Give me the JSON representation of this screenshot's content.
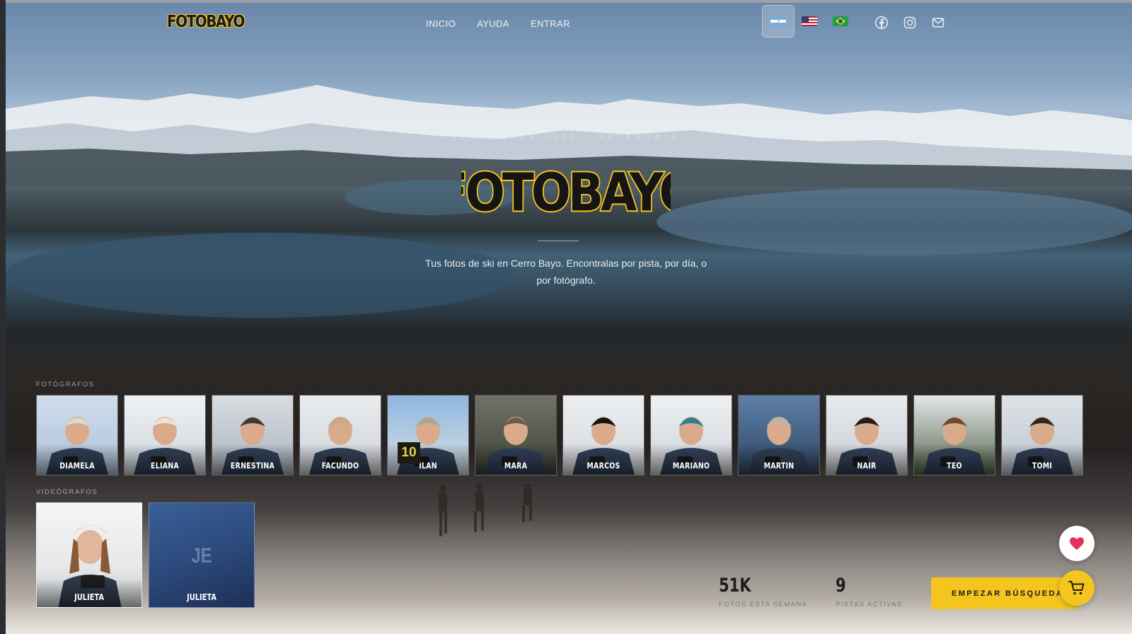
{
  "nav": {
    "logo": "FOTOBAYO",
    "links": [
      "INICIO",
      "AYUDA",
      "ENTRAR"
    ],
    "languages": [
      {
        "code": "ar",
        "icon": "argentina-flag-icon",
        "active": true
      },
      {
        "code": "us",
        "icon": "usa-flag-icon",
        "active": false
      },
      {
        "code": "br",
        "icon": "brazil-flag-icon",
        "active": false
      }
    ],
    "social": [
      "facebook-icon",
      "instagram-icon",
      "mail-icon"
    ]
  },
  "hero": {
    "eyebrow": "TEMPORADA 2025 · PATAGONIA",
    "logo": "FOTOBAYO",
    "tagline": "Tus fotos de ski en Cerro Bayo. Encontralas por pista, por día, o por fotógrafo."
  },
  "photographers": {
    "label": "FOTÓGRAFOS",
    "items": [
      "DIAMELA",
      "ELIANA",
      "ERNESTINA",
      "FACUNDO",
      "ILAN",
      "MARA",
      "MARCOS",
      "MARIANO",
      "MARTIN",
      "NAIR",
      "TEO",
      "TOMI"
    ],
    "badge": {
      "name": "ILAN",
      "text": "10"
    }
  },
  "videographers": {
    "label": "VIDEÓGRAFOS",
    "items": [
      {
        "name": "JULIETA",
        "initials": ""
      },
      {
        "name": "JULIETA",
        "initials": "JE"
      }
    ]
  },
  "stats": [
    {
      "value": "51K",
      "label": "FOTOS ESTA SEMANA"
    },
    {
      "value": "9",
      "label": "PISTAS ACTIVAS"
    }
  ],
  "cta": {
    "label": "EMPEZAR BÚSQUEDA →"
  },
  "colors": {
    "accent": "#f3c51e",
    "heart": "#e0335a"
  }
}
